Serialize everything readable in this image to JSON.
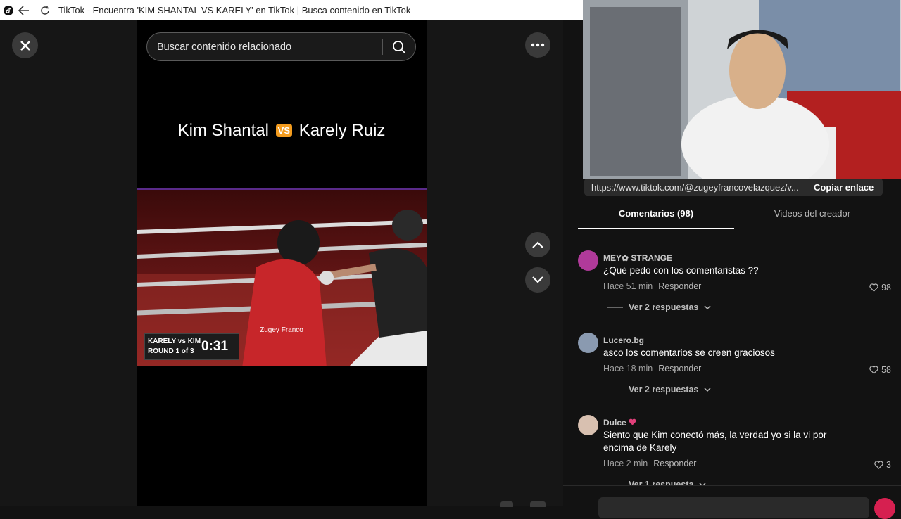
{
  "window": {
    "title": "TikTok - Encuentra 'KIM SHANTAL VS KARELY' en TikTok | Busca contenido en TikTok"
  },
  "search": {
    "placeholder": "Buscar contenido relacionado"
  },
  "video": {
    "title_left": "Kim Shantal",
    "vs_badge": "VS",
    "title_right": "Karely Ruiz",
    "score_line1": "KARELY vs KIM",
    "score_line2": "ROUND 1 of 3",
    "timer": "0:31",
    "watermark": "Zugey Franco"
  },
  "share": {
    "url": "https://www.tiktok.com/@zugeyfrancovelazquez/v...",
    "copy_label": "Copiar enlace"
  },
  "tabs": {
    "comments": "Comentarios (98)",
    "creator_videos": "Videos del creador"
  },
  "comments": [
    {
      "user": "MEY✿ STRANGE",
      "text": "¿Qué pedo con los comentaristas ??",
      "time": "Hace 51 min",
      "reply": "Responder",
      "likes": "98",
      "replies": "Ver 2 respuestas"
    },
    {
      "user": "Lucero.bg",
      "text": "asco los comentarios se creen graciosos",
      "time": "Hace 18 min",
      "reply": "Responder",
      "likes": "58",
      "replies": "Ver 2 respuestas"
    },
    {
      "user": "Dulce",
      "text": "Siento que Kim conectó más, la verdad yo si la vi por encima de Karely",
      "time": "Hace 2 min",
      "reply": "Responder",
      "likes": "3",
      "replies": "Ver 1 respuesta"
    }
  ],
  "colors": {
    "accent": "#fe2c55",
    "badge": "#f39c1f"
  }
}
